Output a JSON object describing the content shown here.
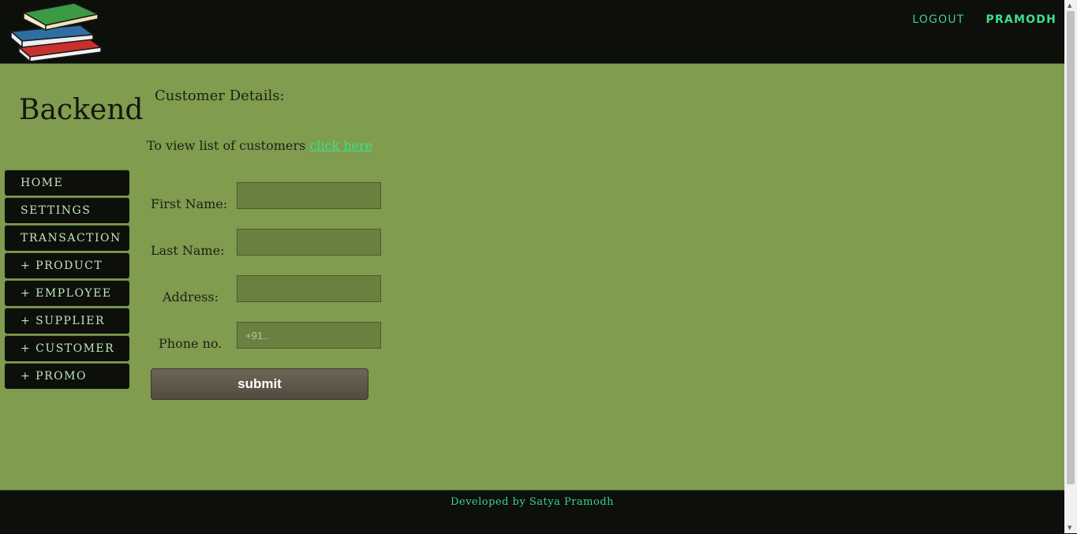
{
  "header": {
    "logo_icon": "books-stack-icon",
    "nav": {
      "logout": "LOGOUT",
      "user": "PRAMODH"
    }
  },
  "sidebar": {
    "title": "Backend",
    "items": [
      {
        "label": "HOME"
      },
      {
        "label": "SETTINGS"
      },
      {
        "label": "TRANSACTION"
      },
      {
        "label": "+ PRODUCT"
      },
      {
        "label": "+ EMPLOYEE"
      },
      {
        "label": "+ SUPPLIER"
      },
      {
        "label": "+ CUSTOMER"
      },
      {
        "label": "+ PROMO"
      }
    ]
  },
  "main": {
    "heading": "Customer Details:",
    "view_text": "To view list of customers ",
    "view_link": "click here",
    "form": {
      "first_name_label": "First Name:",
      "last_name_label": "Last Name:",
      "address_label": "Address:",
      "phone_label": "Phone no.",
      "first_name_value": "",
      "last_name_value": "",
      "address_value": "",
      "phone_placeholder": "+91..",
      "submit_label": "submit"
    }
  },
  "footer": {
    "text": "Developed by Satya Pramodh"
  },
  "colors": {
    "page_bg": "#7f9c4f",
    "header_bg": "#0d0f0a",
    "accent": "#3ee08c",
    "nav_item_text": "#bfe6c2"
  }
}
